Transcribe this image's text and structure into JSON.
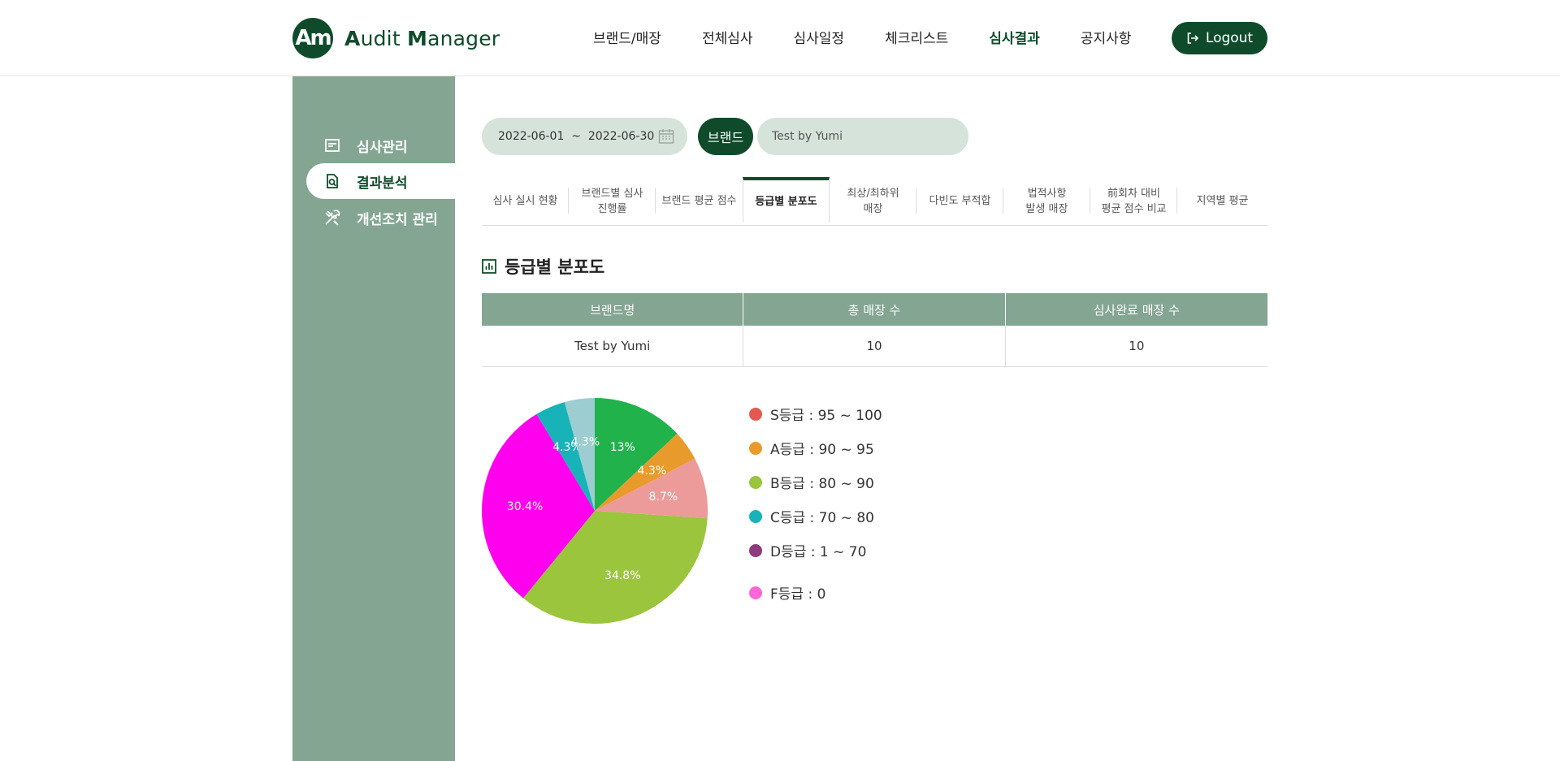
{
  "header": {
    "logo_mark": "Am",
    "logo_name_1": "A",
    "logo_name_2": "udit ",
    "logo_name_3": "M",
    "logo_name_4": "anager",
    "nav": [
      "브랜드/매장",
      "전체심사",
      "심사일정",
      "체크리스트",
      "심사결과",
      "공지사항"
    ],
    "active_nav": "심사결과",
    "logout_label": "Logout"
  },
  "sidebar": {
    "items": [
      {
        "label": "심사관리",
        "icon": "document-icon"
      },
      {
        "label": "결과분석",
        "icon": "search-document-icon",
        "active": true
      },
      {
        "label": "개선조치 관리",
        "icon": "tools-icon"
      }
    ]
  },
  "filters": {
    "date_range": "2022-06-01  ~  2022-06-30",
    "brand_label": "브랜드",
    "brand_value": "Test by Yumi"
  },
  "tabs": [
    {
      "label": "심사 실시 현황"
    },
    {
      "label": "브랜드별 심사\n진행률"
    },
    {
      "label": "브랜드 평균 점수"
    },
    {
      "label": "등급별 분포도",
      "active": true
    },
    {
      "label": "최상/최하위\n매장"
    },
    {
      "label": "다빈도 부적합"
    },
    {
      "label": "법적사항\n발생 매장"
    },
    {
      "label": "前회차 대비\n평균 점수 비교"
    },
    {
      "label": "지역별 평균"
    }
  ],
  "section": {
    "title": "등급별 분포도",
    "table": {
      "headers": [
        "브랜드명",
        "총 매장 수",
        "심사완료 매장 수"
      ],
      "rows": [
        [
          "Test by Yumi",
          "10",
          "10"
        ]
      ]
    }
  },
  "legend": [
    {
      "label": "S등급 : 95 ~ 100",
      "color": "#e5584f"
    },
    {
      "label": "A등급 : 90 ~ 95",
      "color": "#e89b2b"
    },
    {
      "label": "B등급 : 80 ~ 90",
      "color": "#9bc53c"
    },
    {
      "label": "C등급 : 70 ~ 80",
      "color": "#17b3b8"
    },
    {
      "label": "D등급 : 1 ~ 70",
      "color": "#8e3a7e"
    },
    {
      "label": "F등급 : 0",
      "color": "#ff66d6"
    }
  ],
  "chart_data": {
    "type": "pie",
    "slices": [
      {
        "value": 13,
        "label": "13%",
        "color": "#22b24c"
      },
      {
        "value": 4.3,
        "label": "4.3%",
        "color": "#e89b2b"
      },
      {
        "value": 8.7,
        "label": "8.7%",
        "color": "#ed9a9a"
      },
      {
        "value": 34.8,
        "label": "34.8%",
        "color": "#9bc53c"
      },
      {
        "value": 30.4,
        "label": "30.4%",
        "color": "#ff00ee"
      },
      {
        "value": 4.3,
        "label": "4.3%",
        "color": "#17b3b8"
      },
      {
        "value": 4.3,
        "label": "4.3%",
        "color": "#9ccdd0"
      }
    ],
    "start_angle": "12 o'clock",
    "direction": "clockwise"
  }
}
